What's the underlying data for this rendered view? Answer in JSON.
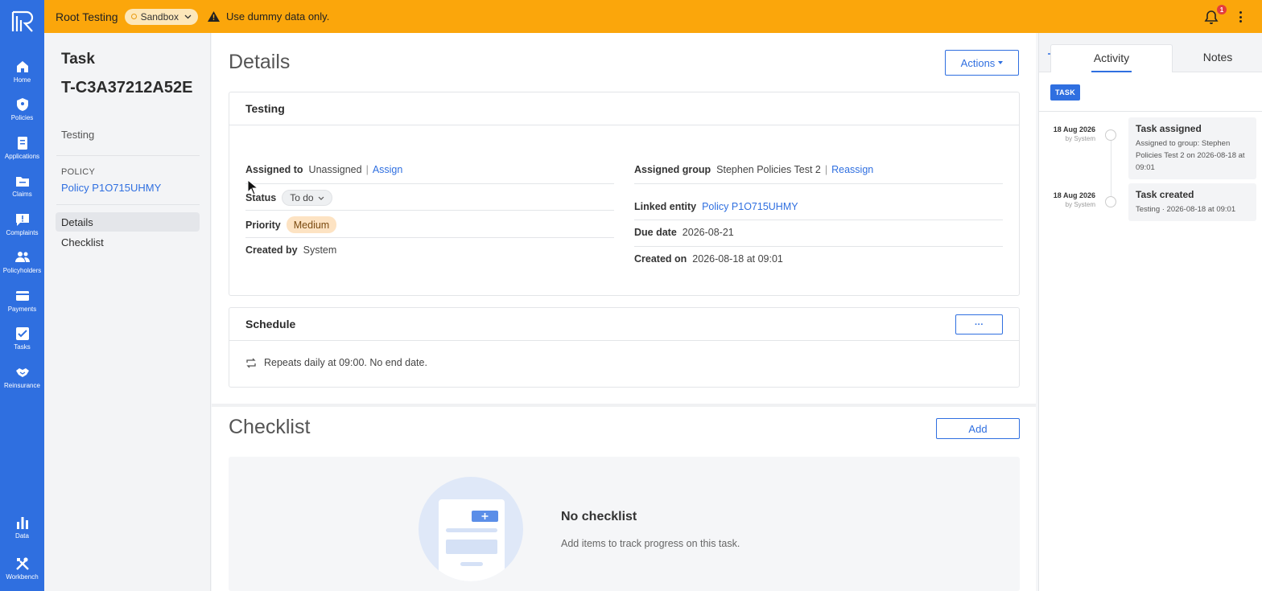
{
  "nav": {
    "items": [
      {
        "label": "Home",
        "icon": "home-icon"
      },
      {
        "label": "Policies",
        "icon": "shield-icon"
      },
      {
        "label": "Applications",
        "icon": "document-icon"
      },
      {
        "label": "Claims",
        "icon": "folder-icon"
      },
      {
        "label": "Complaints",
        "icon": "chat-alert-icon"
      },
      {
        "label": "Policyholders",
        "icon": "people-icon"
      },
      {
        "label": "Payments",
        "icon": "card-icon"
      },
      {
        "label": "Tasks",
        "icon": "checkbox-icon"
      },
      {
        "label": "Reinsurance",
        "icon": "handshake-icon"
      },
      {
        "label": "Data",
        "icon": "bar-chart-icon"
      },
      {
        "label": "Workbench",
        "icon": "tools-icon"
      }
    ]
  },
  "banner": {
    "org": "Root Testing",
    "environment": "Sandbox",
    "warning": "Use dummy data only.",
    "notification_count": "1",
    "color": "#fba60b"
  },
  "sidebar": {
    "type_label": "Task",
    "task_id": "T-C3A37212A52E",
    "subtitle": "Testing",
    "policy_label": "POLICY",
    "policy_link": "Policy P1O715UHMY",
    "nav": [
      {
        "label": "Details"
      },
      {
        "label": "Checklist"
      }
    ]
  },
  "details": {
    "heading": "Details",
    "actions_label": "Actions",
    "card_title": "Testing",
    "assigned_to_label": "Assigned to",
    "assigned_to_value": "Unassigned",
    "assign_link": "Assign",
    "status_label": "Status",
    "status_value": "To do",
    "priority_label": "Priority",
    "priority_value": "Medium",
    "created_by_label": "Created by",
    "created_by_value": "System",
    "assigned_group_label": "Assigned group",
    "assigned_group_value": "Stephen Policies Test 2",
    "reassign_link": "Reassign",
    "linked_entity_label": "Linked entity",
    "linked_entity_value": "Policy P1O715UHMY",
    "due_date_label": "Due date",
    "due_date_value": "2026-08-21",
    "created_on_label": "Created on",
    "created_on_value": "2026-08-18 at 09:01"
  },
  "schedule": {
    "title": "Schedule",
    "more_label": "···",
    "text": "Repeats daily at 09:00. No end date."
  },
  "checklist": {
    "heading": "Checklist",
    "add_label": "Add",
    "empty_title": "No checklist",
    "empty_sub": "Add items to track progress on this task."
  },
  "activity": {
    "tabs": [
      "Activity",
      "Notes"
    ],
    "tag": "TASK",
    "events": [
      {
        "date": "18 Aug 2026",
        "by": "by System",
        "title": "Task assigned",
        "desc": "Assigned to group: Stephen Policies Test 2 on 2026-08-18 at 09:01"
      },
      {
        "date": "18 Aug 2026",
        "by": "by System",
        "title": "Task created",
        "desc": "Testing · 2026-08-18 at 09:01"
      }
    ]
  },
  "colors": {
    "accent": "#2f6fe0",
    "priority_bg": "#fde3c3"
  }
}
